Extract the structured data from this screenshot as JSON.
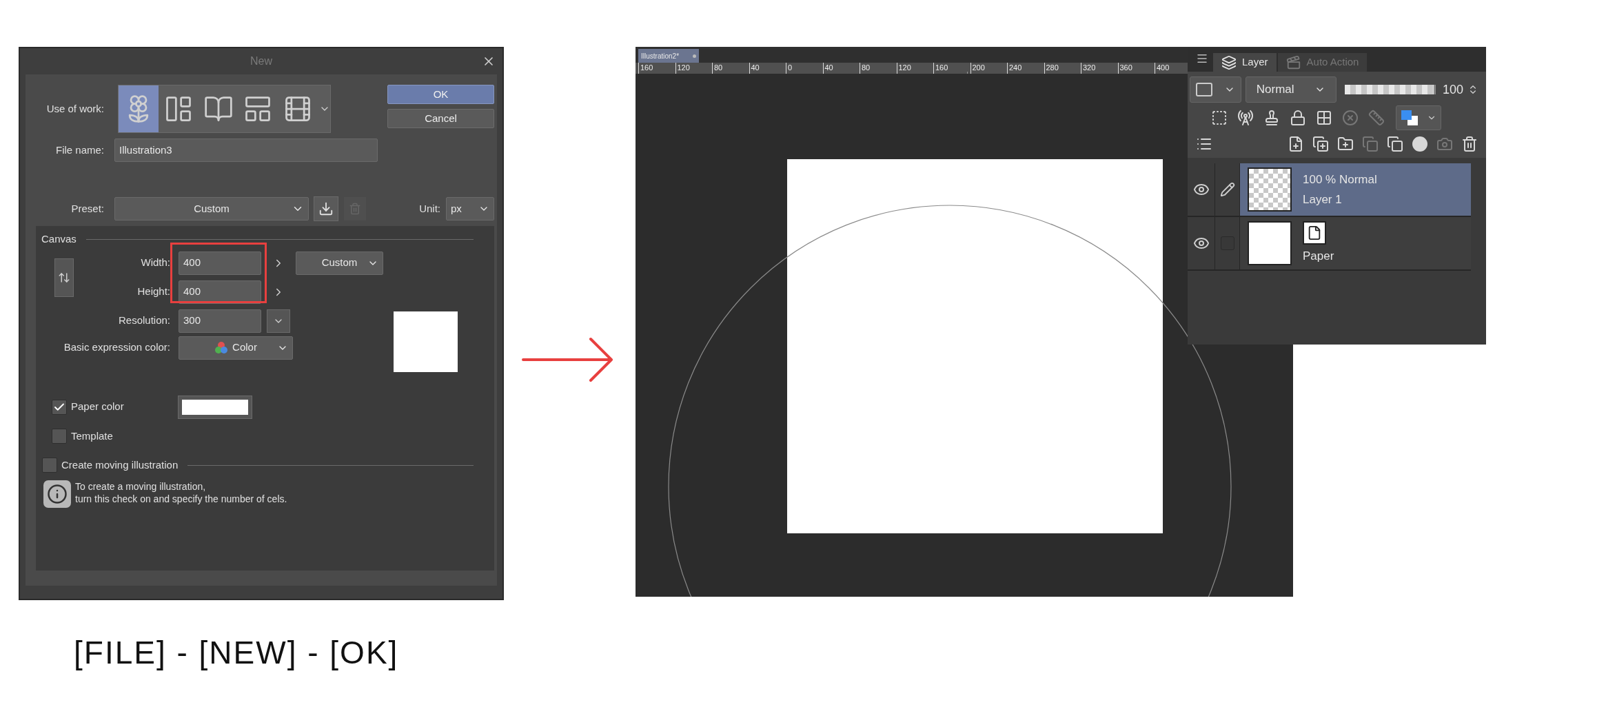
{
  "dialog": {
    "title": "New",
    "use_of_work": {
      "label": "Use of work:",
      "options": [
        {
          "kind": "illustration",
          "selected": true
        },
        {
          "kind": "comic",
          "selected": false
        },
        {
          "kind": "book",
          "selected": false
        },
        {
          "kind": "comic-settings",
          "selected": false
        },
        {
          "kind": "animation",
          "selected": false
        }
      ]
    },
    "buttons": [
      "OK",
      "Cancel"
    ],
    "file_name": {
      "label": "File name:",
      "value": "Illustration3"
    },
    "preset": {
      "label": "Preset:",
      "value": "Custom"
    },
    "unit": {
      "label": "Unit:",
      "value": "px"
    },
    "canvas": {
      "heading": "Canvas",
      "width": {
        "label": "Width:",
        "value": "400"
      },
      "height": {
        "label": "Height:",
        "value": "400"
      },
      "size_preset": "Custom",
      "resolution": {
        "label": "Resolution:",
        "value": "300"
      },
      "basic_expression_color": {
        "label": "Basic expression color:",
        "value": "Color"
      },
      "paper_color": {
        "label": "Paper color",
        "checked": true
      },
      "template": {
        "label": "Template",
        "checked": false
      }
    },
    "moving_illustration": {
      "label": "Create moving illustration",
      "checked": false,
      "info": [
        "To create a moving illustration,",
        "turn this check on and specify the number of cels."
      ]
    }
  },
  "caption": "[FILE] - [NEW] - [OK]",
  "canvas_window": {
    "tab": "Illustration2*",
    "ruler": [
      "160",
      "120",
      "80",
      "40",
      "0",
      "40",
      "80",
      "120",
      "160",
      "200",
      "240",
      "280",
      "320",
      "360",
      "400"
    ]
  },
  "layer_panel": {
    "tabs": [
      {
        "label": "Layer",
        "selected": true
      },
      {
        "label": "Auto Action",
        "selected": false
      }
    ],
    "blend_mode": "Normal",
    "opacity": {
      "level": 1,
      "reading": "100"
    },
    "layers": [
      {
        "kind": "raster",
        "mode": "100 % Normal",
        "name": "Layer 1",
        "selected": true,
        "visible": true,
        "editing": true
      },
      {
        "kind": "paper",
        "name": "Paper",
        "selected": false,
        "visible": true,
        "editing": false
      }
    ]
  }
}
